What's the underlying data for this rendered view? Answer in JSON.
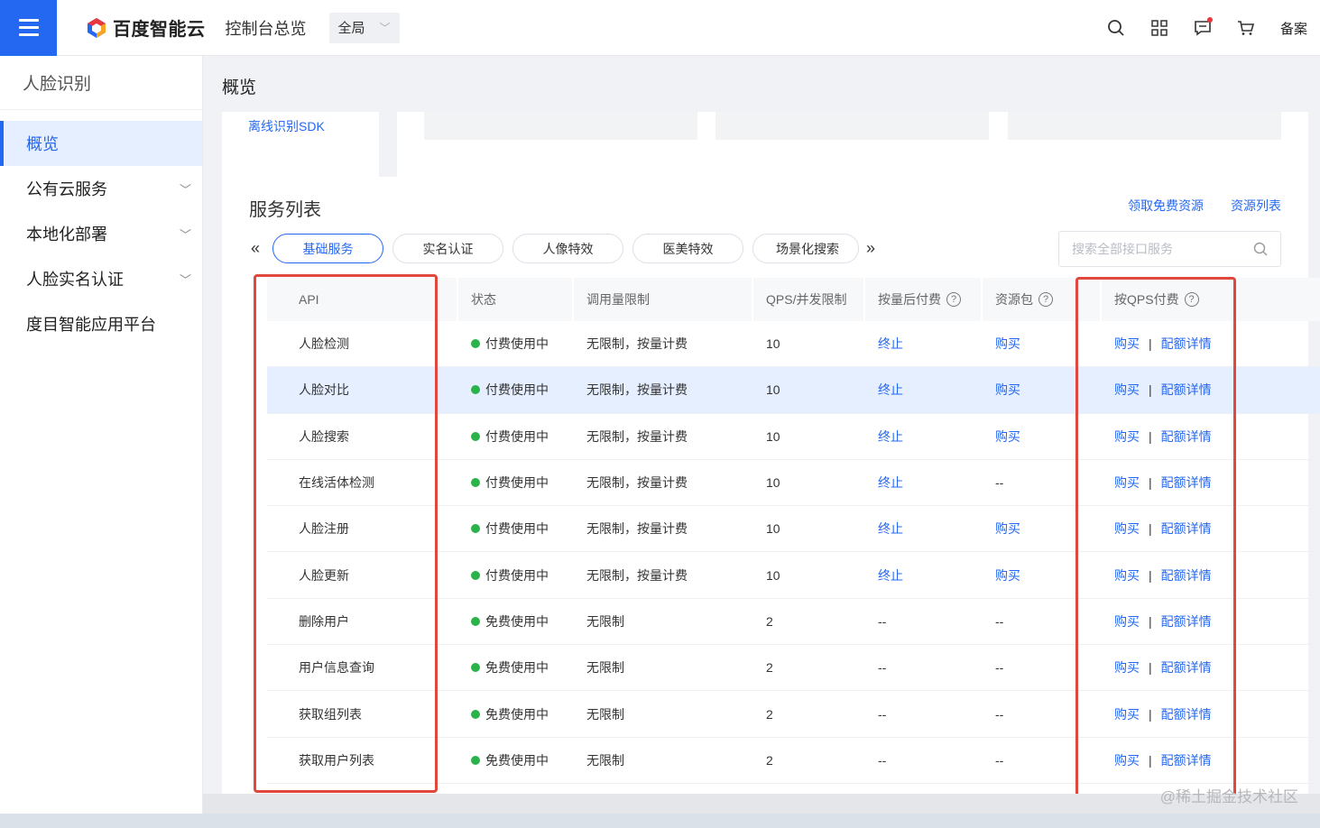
{
  "header": {
    "brand": "百度智能云",
    "console_link": "控制台总览",
    "scope": "全局",
    "beian": "备案",
    "icons": [
      "search-icon",
      "grid-apps-icon",
      "message-icon",
      "cart-icon"
    ]
  },
  "sidebar": {
    "title": "人脸识别",
    "items": [
      {
        "label": "概览",
        "active": true,
        "expandable": false
      },
      {
        "label": "公有云服务",
        "active": false,
        "expandable": true
      },
      {
        "label": "本地化部署",
        "active": false,
        "expandable": true
      },
      {
        "label": "人脸实名认证",
        "active": false,
        "expandable": true
      },
      {
        "label": "度目智能应用平台",
        "active": false,
        "expandable": false
      }
    ]
  },
  "main": {
    "page_title": "概览",
    "sdk_link": "离线识别SDK",
    "service": {
      "title": "服务列表",
      "links": [
        "领取免费资源",
        "资源列表"
      ],
      "tabs": [
        "基础服务",
        "实名认证",
        "人像特效",
        "医美特效",
        "场景化搜索"
      ],
      "active_tab": 0,
      "search_placeholder": "搜索全部接口服务",
      "columns": [
        "API",
        "状态",
        "调用量限制",
        "QPS/并发限制",
        "按量后付费",
        "资源包",
        "按QPS付费"
      ],
      "rows": [
        {
          "api": "人脸检测",
          "status": "付费使用中",
          "quota": "无限制，按量计费",
          "qps": "10",
          "postpaid": "终止",
          "package": "购买",
          "qps_buy": "购买",
          "qps_detail": "配额详情"
        },
        {
          "api": "人脸对比",
          "status": "付费使用中",
          "quota": "无限制，按量计费",
          "qps": "10",
          "postpaid": "终止",
          "package": "购买",
          "qps_buy": "购买",
          "qps_detail": "配额详情"
        },
        {
          "api": "人脸搜索",
          "status": "付费使用中",
          "quota": "无限制，按量计费",
          "qps": "10",
          "postpaid": "终止",
          "package": "购买",
          "qps_buy": "购买",
          "qps_detail": "配额详情"
        },
        {
          "api": "在线活体检测",
          "status": "付费使用中",
          "quota": "无限制，按量计费",
          "qps": "10",
          "postpaid": "终止",
          "package": "--",
          "qps_buy": "购买",
          "qps_detail": "配额详情"
        },
        {
          "api": "人脸注册",
          "status": "付费使用中",
          "quota": "无限制，按量计费",
          "qps": "10",
          "postpaid": "终止",
          "package": "购买",
          "qps_buy": "购买",
          "qps_detail": "配额详情"
        },
        {
          "api": "人脸更新",
          "status": "付费使用中",
          "quota": "无限制，按量计费",
          "qps": "10",
          "postpaid": "终止",
          "package": "购买",
          "qps_buy": "购买",
          "qps_detail": "配额详情"
        },
        {
          "api": "删除用户",
          "status": "免费使用中",
          "quota": "无限制",
          "qps": "2",
          "postpaid": "--",
          "package": "--",
          "qps_buy": "购买",
          "qps_detail": "配额详情"
        },
        {
          "api": "用户信息查询",
          "status": "免费使用中",
          "quota": "无限制",
          "qps": "2",
          "postpaid": "--",
          "package": "--",
          "qps_buy": "购买",
          "qps_detail": "配额详情"
        },
        {
          "api": "获取组列表",
          "status": "免费使用中",
          "quota": "无限制",
          "qps": "2",
          "postpaid": "--",
          "package": "--",
          "qps_buy": "购买",
          "qps_detail": "配额详情"
        },
        {
          "api": "获取用户列表",
          "status": "免费使用中",
          "quota": "无限制",
          "qps": "2",
          "postpaid": "--",
          "package": "--",
          "qps_buy": "购买",
          "qps_detail": "配额详情"
        }
      ],
      "highlighted_row": 1,
      "help_icon_columns": [
        4,
        5,
        6
      ]
    }
  },
  "watermark": "@稀土掘金技术社区",
  "colors": {
    "accent": "#2468f2",
    "status_green": "#29b34a",
    "annotation_red": "#e0483d",
    "row_highlight": "#e6efff"
  }
}
